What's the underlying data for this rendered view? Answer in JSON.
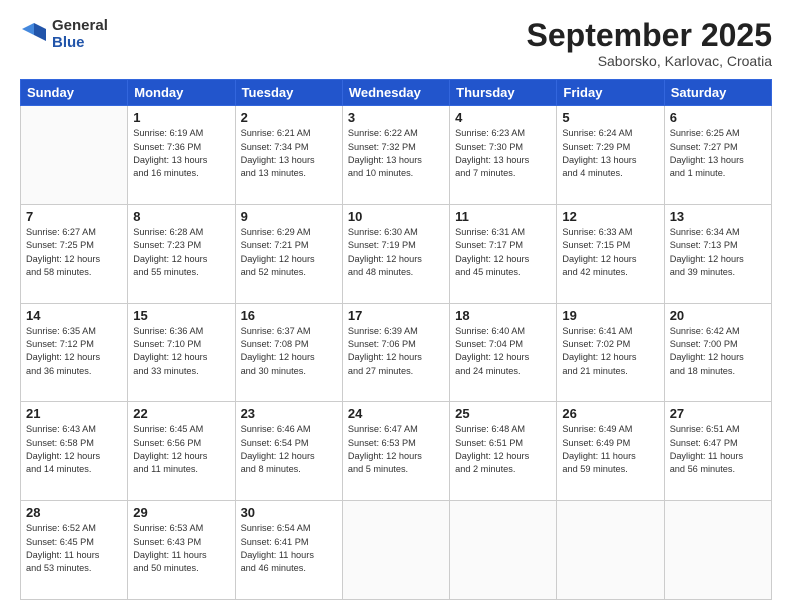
{
  "logo": {
    "general": "General",
    "blue": "Blue"
  },
  "title": "September 2025",
  "location": "Saborsko, Karlovac, Croatia",
  "days_header": [
    "Sunday",
    "Monday",
    "Tuesday",
    "Wednesday",
    "Thursday",
    "Friday",
    "Saturday"
  ],
  "weeks": [
    [
      {
        "num": "",
        "info": ""
      },
      {
        "num": "1",
        "info": "Sunrise: 6:19 AM\nSunset: 7:36 PM\nDaylight: 13 hours\nand 16 minutes."
      },
      {
        "num": "2",
        "info": "Sunrise: 6:21 AM\nSunset: 7:34 PM\nDaylight: 13 hours\nand 13 minutes."
      },
      {
        "num": "3",
        "info": "Sunrise: 6:22 AM\nSunset: 7:32 PM\nDaylight: 13 hours\nand 10 minutes."
      },
      {
        "num": "4",
        "info": "Sunrise: 6:23 AM\nSunset: 7:30 PM\nDaylight: 13 hours\nand 7 minutes."
      },
      {
        "num": "5",
        "info": "Sunrise: 6:24 AM\nSunset: 7:29 PM\nDaylight: 13 hours\nand 4 minutes."
      },
      {
        "num": "6",
        "info": "Sunrise: 6:25 AM\nSunset: 7:27 PM\nDaylight: 13 hours\nand 1 minute."
      }
    ],
    [
      {
        "num": "7",
        "info": "Sunrise: 6:27 AM\nSunset: 7:25 PM\nDaylight: 12 hours\nand 58 minutes."
      },
      {
        "num": "8",
        "info": "Sunrise: 6:28 AM\nSunset: 7:23 PM\nDaylight: 12 hours\nand 55 minutes."
      },
      {
        "num": "9",
        "info": "Sunrise: 6:29 AM\nSunset: 7:21 PM\nDaylight: 12 hours\nand 52 minutes."
      },
      {
        "num": "10",
        "info": "Sunrise: 6:30 AM\nSunset: 7:19 PM\nDaylight: 12 hours\nand 48 minutes."
      },
      {
        "num": "11",
        "info": "Sunrise: 6:31 AM\nSunset: 7:17 PM\nDaylight: 12 hours\nand 45 minutes."
      },
      {
        "num": "12",
        "info": "Sunrise: 6:33 AM\nSunset: 7:15 PM\nDaylight: 12 hours\nand 42 minutes."
      },
      {
        "num": "13",
        "info": "Sunrise: 6:34 AM\nSunset: 7:13 PM\nDaylight: 12 hours\nand 39 minutes."
      }
    ],
    [
      {
        "num": "14",
        "info": "Sunrise: 6:35 AM\nSunset: 7:12 PM\nDaylight: 12 hours\nand 36 minutes."
      },
      {
        "num": "15",
        "info": "Sunrise: 6:36 AM\nSunset: 7:10 PM\nDaylight: 12 hours\nand 33 minutes."
      },
      {
        "num": "16",
        "info": "Sunrise: 6:37 AM\nSunset: 7:08 PM\nDaylight: 12 hours\nand 30 minutes."
      },
      {
        "num": "17",
        "info": "Sunrise: 6:39 AM\nSunset: 7:06 PM\nDaylight: 12 hours\nand 27 minutes."
      },
      {
        "num": "18",
        "info": "Sunrise: 6:40 AM\nSunset: 7:04 PM\nDaylight: 12 hours\nand 24 minutes."
      },
      {
        "num": "19",
        "info": "Sunrise: 6:41 AM\nSunset: 7:02 PM\nDaylight: 12 hours\nand 21 minutes."
      },
      {
        "num": "20",
        "info": "Sunrise: 6:42 AM\nSunset: 7:00 PM\nDaylight: 12 hours\nand 18 minutes."
      }
    ],
    [
      {
        "num": "21",
        "info": "Sunrise: 6:43 AM\nSunset: 6:58 PM\nDaylight: 12 hours\nand 14 minutes."
      },
      {
        "num": "22",
        "info": "Sunrise: 6:45 AM\nSunset: 6:56 PM\nDaylight: 12 hours\nand 11 minutes."
      },
      {
        "num": "23",
        "info": "Sunrise: 6:46 AM\nSunset: 6:54 PM\nDaylight: 12 hours\nand 8 minutes."
      },
      {
        "num": "24",
        "info": "Sunrise: 6:47 AM\nSunset: 6:53 PM\nDaylight: 12 hours\nand 5 minutes."
      },
      {
        "num": "25",
        "info": "Sunrise: 6:48 AM\nSunset: 6:51 PM\nDaylight: 12 hours\nand 2 minutes."
      },
      {
        "num": "26",
        "info": "Sunrise: 6:49 AM\nSunset: 6:49 PM\nDaylight: 11 hours\nand 59 minutes."
      },
      {
        "num": "27",
        "info": "Sunrise: 6:51 AM\nSunset: 6:47 PM\nDaylight: 11 hours\nand 56 minutes."
      }
    ],
    [
      {
        "num": "28",
        "info": "Sunrise: 6:52 AM\nSunset: 6:45 PM\nDaylight: 11 hours\nand 53 minutes."
      },
      {
        "num": "29",
        "info": "Sunrise: 6:53 AM\nSunset: 6:43 PM\nDaylight: 11 hours\nand 50 minutes."
      },
      {
        "num": "30",
        "info": "Sunrise: 6:54 AM\nSunset: 6:41 PM\nDaylight: 11 hours\nand 46 minutes."
      },
      {
        "num": "",
        "info": ""
      },
      {
        "num": "",
        "info": ""
      },
      {
        "num": "",
        "info": ""
      },
      {
        "num": "",
        "info": ""
      }
    ]
  ]
}
